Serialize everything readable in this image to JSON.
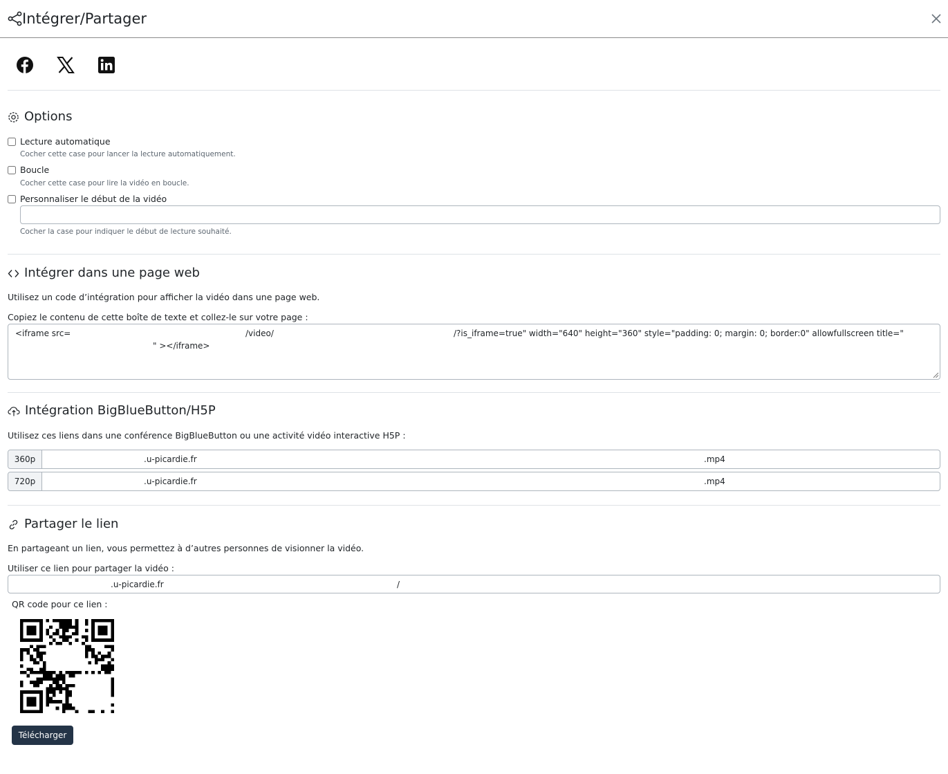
{
  "header": {
    "title": "Intégrer/Partager",
    "icons": {
      "share": "share-nodes-icon",
      "close": "close-icon"
    }
  },
  "social": [
    {
      "name": "facebook",
      "icon": "facebook-icon"
    },
    {
      "name": "x",
      "icon": "x-twitter-icon"
    },
    {
      "name": "linkedin",
      "icon": "linkedin-icon"
    }
  ],
  "options": {
    "title": "Options",
    "icon": "gear-icon",
    "autoplay": {
      "label": "Lecture automatique",
      "help": "Cocher cette case pour lancer la lecture automatiquement.",
      "checked": false
    },
    "loop": {
      "label": "Boucle",
      "help": "Cocher cette case pour lire la vidéo en boucle.",
      "checked": false
    },
    "start": {
      "label": "Personnaliser le début de la vidéo",
      "help": "Cocher la case pour indiquer le début de lecture souhaité.",
      "checked": false,
      "value": ""
    }
  },
  "embed": {
    "title": "Intégrer dans une page web",
    "icon": "code-icon",
    "description": "Utilisez un code d’intégration pour afficher la vidéo dans une page web.",
    "copy_label": "Copiez le contenu de cette boîte de texte et collez-le sur votre page :",
    "code": {
      "part1": "<iframe src=",
      "part2": "/video/",
      "part3": "/?is_iframe=true\" width=\"640\" height=\"360\" style=\"padding: 0; margin: 0; border:0\" allowfullscreen title=\"",
      "part4": "\" ></iframe>"
    }
  },
  "bbb": {
    "title": "Intégration BigBlueButton/H5P",
    "icon": "cloud-upload-icon",
    "description": "Utilisez ces liens dans une conférence BigBlueButton ou une activité vidéo interactive H5P :",
    "links": [
      {
        "quality": "360p",
        "domain": ".u-picardie.fr",
        "ext": ".mp4"
      },
      {
        "quality": "720p",
        "domain": ".u-picardie.fr",
        "ext": ".mp4"
      }
    ]
  },
  "share": {
    "title": "Partager le lien",
    "icon": "link-icon",
    "description": "En partageant un lien, vous permettez à d’autres personnes de visionner la vidéo.",
    "use_label": "Utiliser ce lien pour partager la vidéo :",
    "link": {
      "domain": ".u-picardie.fr",
      "tail": "/"
    },
    "qr_label": "QR code pour ce lien :",
    "qr_icon": "qr-code-image",
    "download": "Télécharger"
  }
}
